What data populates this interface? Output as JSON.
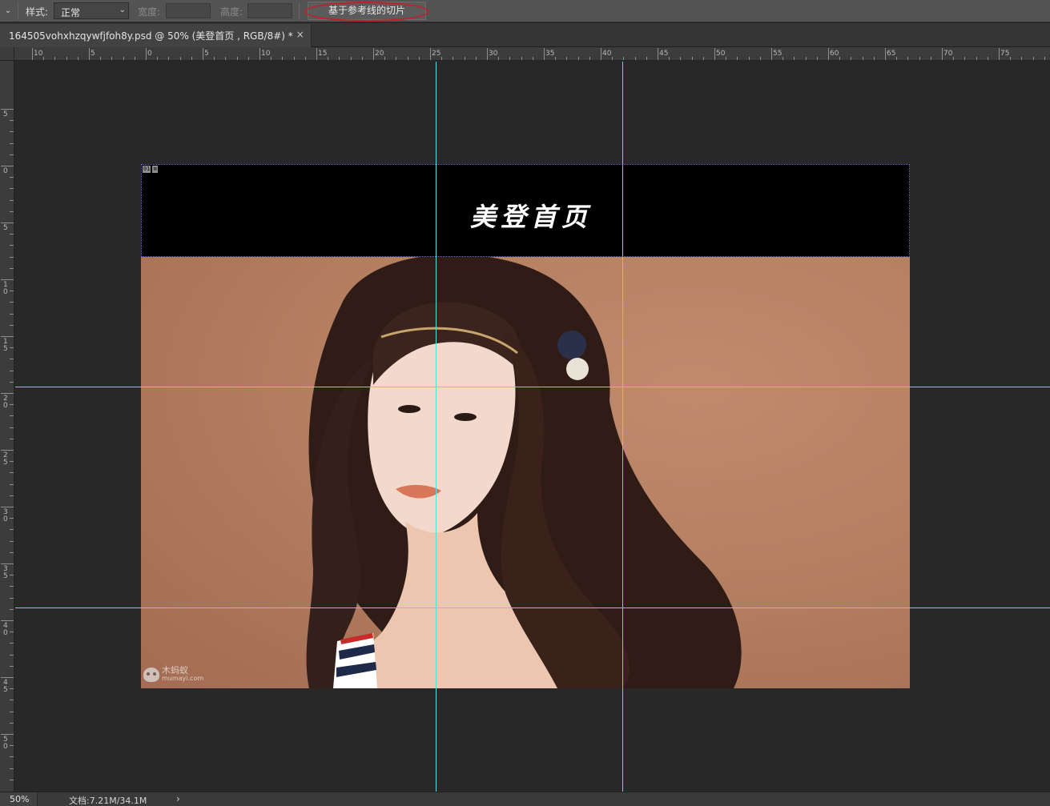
{
  "options_bar": {
    "style_label": "样式:",
    "style_value": "正常",
    "width_label": "宽度:",
    "height_label": "高度:",
    "slice_from_guides_label": "基于参考线的切片"
  },
  "document_tab": {
    "title": "164505vohxhzqywfjfoh8y.psd @ 50% (美登首页 , RGB/8#) *",
    "close_glyph": "×"
  },
  "ruler_h_labels": [
    "10",
    "5",
    "0",
    "5",
    "10",
    "15",
    "20",
    "25",
    "30",
    "35",
    "40",
    "45",
    "50",
    "55",
    "60",
    "65",
    "70",
    "75"
  ],
  "ruler_v_labels": [
    "5",
    "0",
    "5",
    "10",
    "15",
    "20",
    "25",
    "30",
    "35",
    "40",
    "45",
    "50"
  ],
  "canvas": {
    "header_title": "美登首页",
    "slice_number": "01",
    "slice_icon": "image-slice-icon"
  },
  "watermark": {
    "name": "木蚂蚁",
    "url": "mumayi.com"
  },
  "status_bar": {
    "zoom": "50%",
    "doc_size": "文档:7.21M/34.1M",
    "arrow": "›"
  },
  "colors": {
    "guide": "#4fe0e6",
    "highlight_circle": "#c21f2b",
    "workspace": "#282828",
    "photo_background": "#b57f62"
  }
}
